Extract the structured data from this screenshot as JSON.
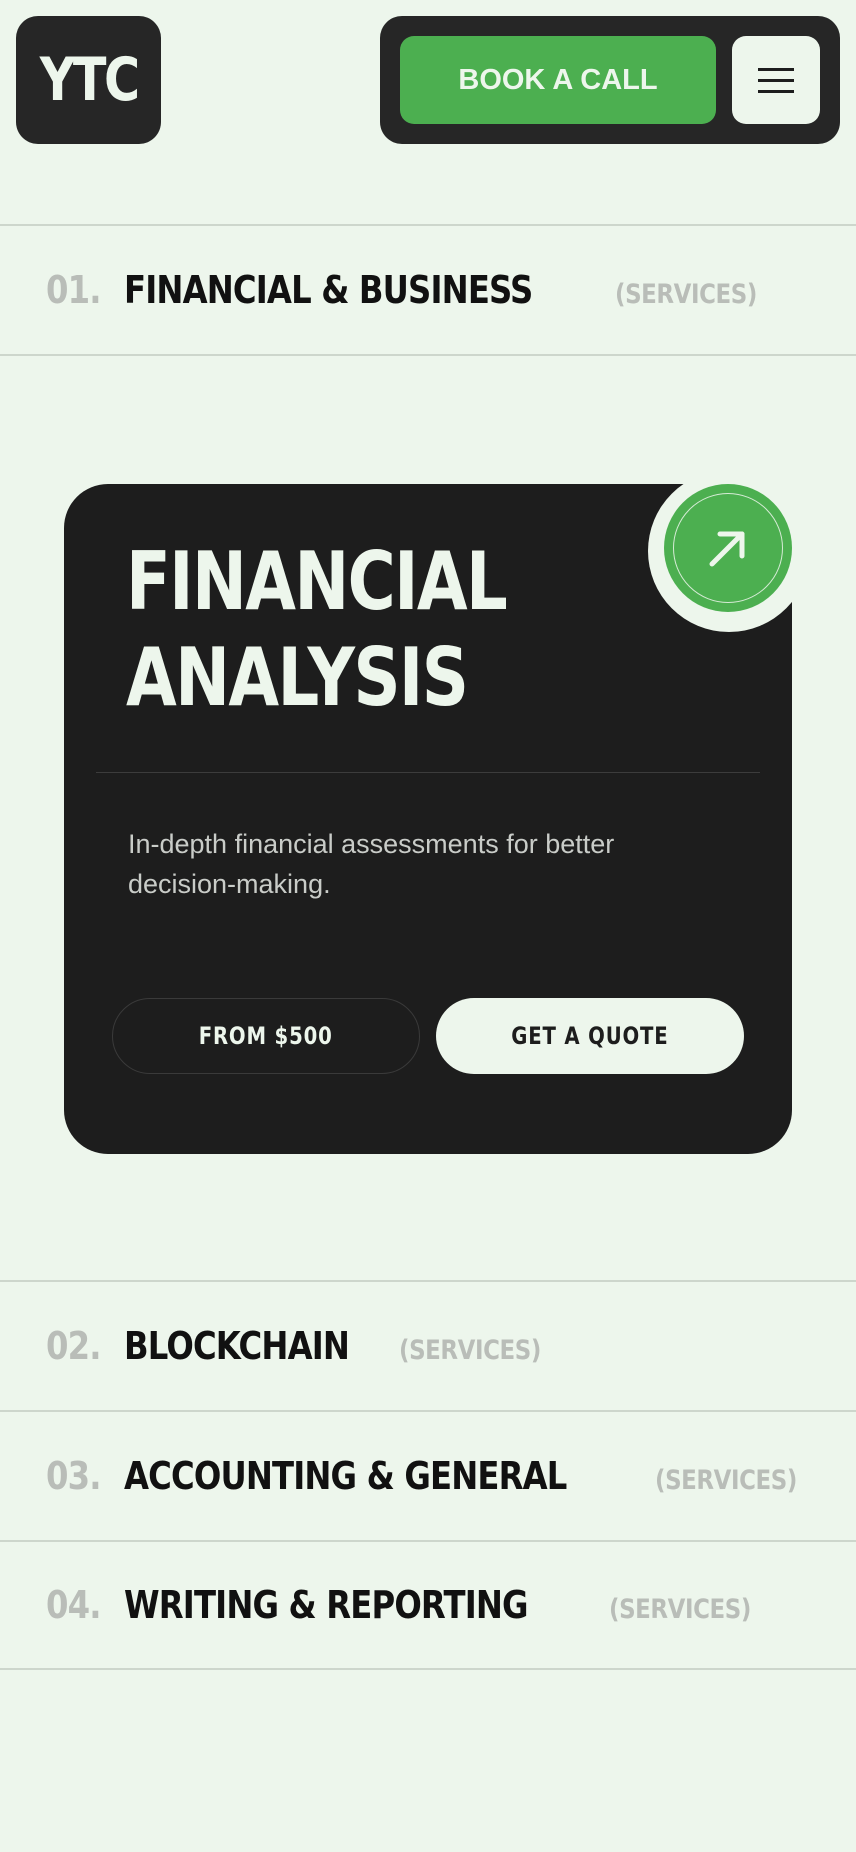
{
  "header": {
    "logo": "YTC",
    "book_label": "BOOK A CALL",
    "menu_icon": "hamburger-icon"
  },
  "services": [
    {
      "num": "01.",
      "title": "FINANCIAL & BUSINESS",
      "tag": "(SERVICES)"
    },
    {
      "num": "02.",
      "title": "BLOCKCHAIN",
      "tag": "(SERVICES)"
    },
    {
      "num": "03.",
      "title": "ACCOUNTING & GENERAL",
      "tag": "(SERVICES)"
    },
    {
      "num": "04.",
      "title": "WRITING & REPORTING",
      "tag": "(SERVICES)"
    }
  ],
  "card": {
    "title_line1": "FINANCIAL",
    "title_line2": "ANALYSIS",
    "description": "In-depth financial assessments for better decision-making.",
    "price": "FROM $500",
    "cta": "GET A QUOTE",
    "arrow_icon": "arrow-up-right-icon"
  },
  "colors": {
    "background": "#edf6ec",
    "dark": "#1d1d1d",
    "accent": "#4caf50",
    "muted": "#b9bdb8"
  }
}
